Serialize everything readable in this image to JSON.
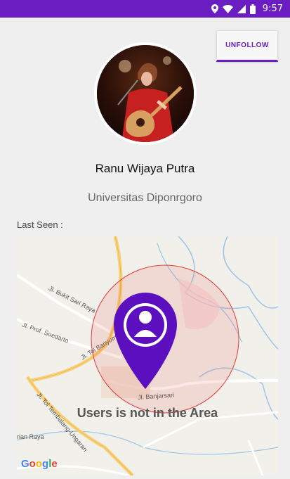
{
  "status_bar": {
    "time": "9:57"
  },
  "actions": {
    "unfollow_label": "UNFOLLOW"
  },
  "profile": {
    "name": "Ranu Wijaya Putra",
    "university": "Universitas Diponrgoro"
  },
  "last_seen": {
    "label": "Last Seen :"
  },
  "map": {
    "message": "Users is not in the Area",
    "attribution": "Google",
    "roads": [
      "Jl. Bukit Sari Raya",
      "Jl. Prof. Soedarto",
      "Jl. Tol Banyumanik",
      "Jl. Banjarsari",
      "Jl. Tol Tembalang-Ungaran",
      "rian Raya"
    ],
    "marker_color": "#5b0fbf",
    "area_color": "#e53935"
  },
  "colors": {
    "accent": "#6a1ec1"
  }
}
